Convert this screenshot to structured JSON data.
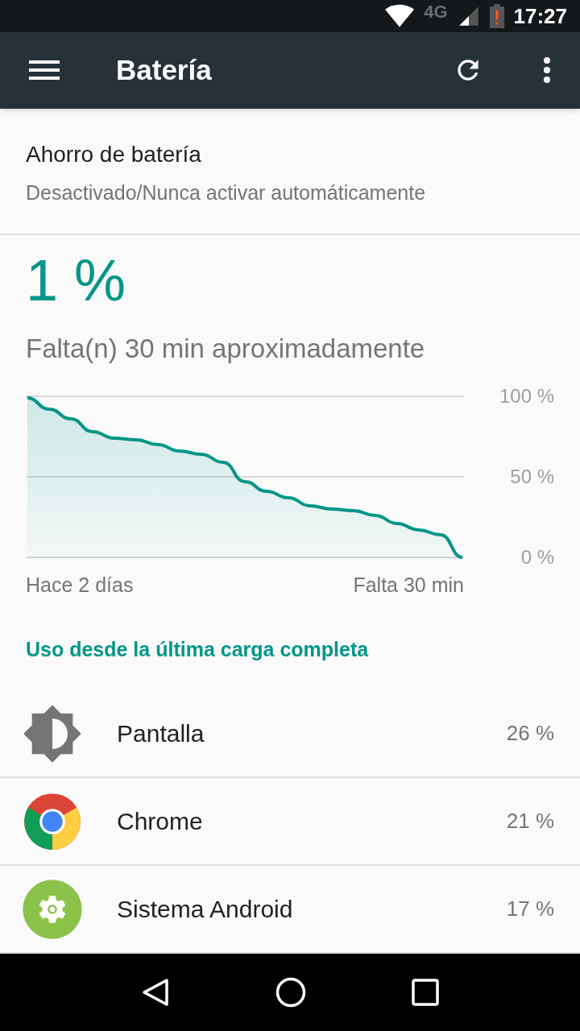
{
  "status_bar": {
    "network": "4G",
    "time": "17:27"
  },
  "toolbar": {
    "title": "Batería"
  },
  "battery_saver": {
    "title": "Ahorro de batería",
    "subtitle": "Desactivado/Nunca activar automáticamente"
  },
  "battery": {
    "percent": "1 %",
    "remaining": "Falta(n) 30 min aproximadamente",
    "history_graph": {
      "y_labels": [
        "100 %",
        "50 %",
        "0 %"
      ],
      "x_labels": [
        "Hace 2 días",
        "Falta 30 min"
      ]
    }
  },
  "usage_header": "Uso desde la última carga completa",
  "usage": [
    {
      "kind": "screen",
      "name": "Pantalla",
      "percent": "26 %"
    },
    {
      "kind": "browser",
      "name": "Chrome",
      "percent": "21 %"
    },
    {
      "kind": "system",
      "name": "Sistema Android",
      "percent": "17 %"
    }
  ]
}
